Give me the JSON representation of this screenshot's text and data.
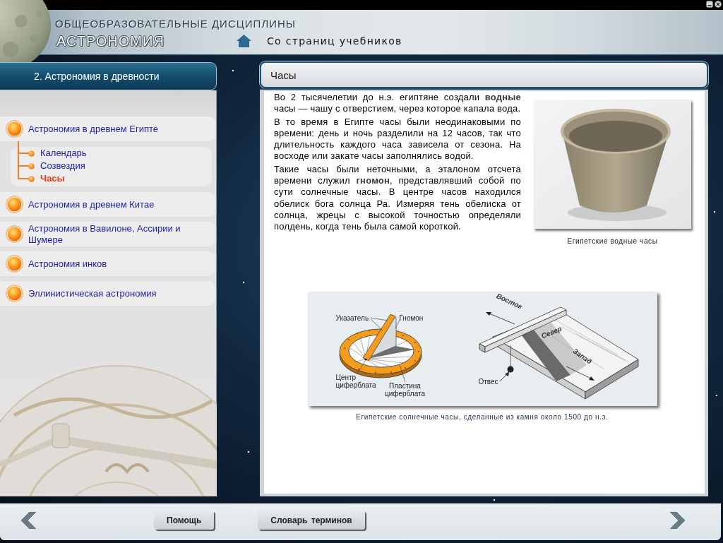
{
  "header": {
    "subtitle": "ОБЩЕОБРАЗОВАТЕЛЬНЫЕ ДИСЦИПЛИНЫ",
    "title": "АСТРОНОМИЯ",
    "breadcrumb": "Со страниц учебников"
  },
  "sidebar": {
    "section": "2. Астрономия в древности",
    "items": [
      {
        "label": "Астрономия в древнем Египте",
        "selected": false,
        "children": [
          {
            "label": "Календарь",
            "selected": false
          },
          {
            "label": "Созвездия",
            "selected": false
          },
          {
            "label": "Часы",
            "selected": true
          }
        ]
      },
      {
        "label": "Астрономия в древнем Китае",
        "selected": false
      },
      {
        "label": "Астрономия в Вавилоне, Ассирии и Шумере",
        "selected": false
      },
      {
        "label": "Астрономия инков",
        "selected": false
      },
      {
        "label": "Эллинистическая астрономия",
        "selected": false
      }
    ]
  },
  "content": {
    "title": "Часы",
    "paragraphs": [
      "Во 2 тысячелетии до н.э. египтяне создали **водные** часы — чашу с отверстием, через которое капала вода.",
      "В то время в Египте часы были неодинаковыми по времени: день и ночь разделили на 12 часов, так что длительность каждого часа зависела от сезона. На восходе или закате часы заполнялись водой.",
      "Такие часы были неточными, а эталоном отсчета времени служил **гномон**, представлявший собой по сути солнечные часы. В центре часов находился обелиск бога солнца Ра. Измеряя тень обелиска от солнца, жрецы с высокой точностью определяли полдень, когда тень была самой короткой."
    ],
    "figures": [
      {
        "kind": "photo",
        "caption": "Египетские водные часы"
      },
      {
        "kind": "diagram",
        "sundial_labels": [
          "Указатель",
          "Гномон",
          "Центр циферблата",
          "Пластина циферблата"
        ],
        "shadow_clock_labels": [
          "Восток",
          "Север",
          "Запад",
          "Отвес"
        ],
        "caption": "Египетские солнечные часы, сделанные из камня около 1500 до н.э."
      }
    ]
  },
  "footer": {
    "buttons": [
      "Помощь",
      "Словарь терминов"
    ]
  }
}
